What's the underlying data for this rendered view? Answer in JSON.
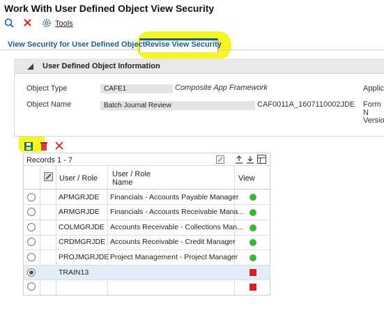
{
  "window": {
    "title": "Work With User Defined Object View Security"
  },
  "toolbar": {
    "tools_label": "Tools"
  },
  "tabs": [
    {
      "label": "View Security for User Defined Object"
    },
    {
      "label": "Revise View Security"
    }
  ],
  "info_panel": {
    "title": "User Defined Object Information",
    "object_type_label": "Object Type",
    "object_type_value": "CAFE1",
    "object_type_desc": "Composite App Framework",
    "object_name_label": "Object Name",
    "object_name_value": "Batch Journal Review",
    "object_name_id": "CAF0011A_1607110002JDE",
    "right_label_1": "Applica",
    "right_label_2": "Form N",
    "right_label_3": "Version"
  },
  "grid": {
    "records_label": "Records 1 - 7",
    "col_user_role": "User / Role",
    "col_name": "User / Role Name",
    "col_view": "View",
    "rows": [
      {
        "user_role": "APMGRJDE",
        "name": "Financials - Accounts Payable Manager",
        "view": "green",
        "selected": false
      },
      {
        "user_role": "ARMGRJDE",
        "name": "Financials - Accounts Receivable Mana...",
        "view": "green",
        "selected": false
      },
      {
        "user_role": "COLMGRJDE",
        "name": "Accounts Receivable - Collections Man...",
        "view": "green",
        "selected": false
      },
      {
        "user_role": "CRDMGRJDE",
        "name": "Accounts Receivable - Credit Manager",
        "view": "green",
        "selected": false
      },
      {
        "user_role": "PROJMGRJDE",
        "name": "Project Management - Project Manager",
        "view": "green",
        "selected": false
      },
      {
        "user_role": "TRAIN13",
        "name": "",
        "view": "red",
        "selected": true
      },
      {
        "user_role": "",
        "name": "",
        "view": "red",
        "selected": false
      }
    ]
  },
  "colors": {
    "accent": "#1a5d94",
    "green": "#3ab53a",
    "red": "#d62020",
    "highlight": "#f4f400"
  }
}
